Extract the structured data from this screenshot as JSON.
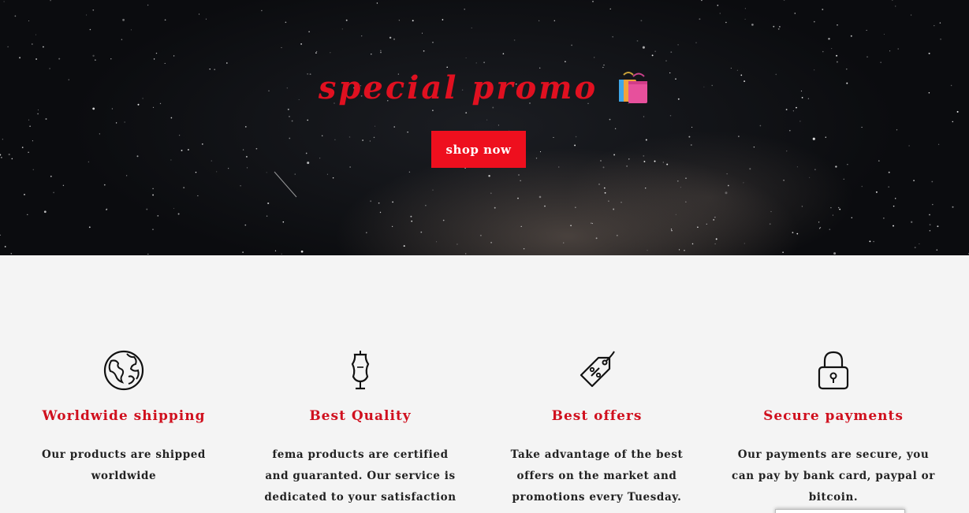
{
  "hero": {
    "title": "special promo",
    "emoji": "shopping-bags-icon",
    "button_label": "shop now",
    "accent_color": "#ee0f1e"
  },
  "features": [
    {
      "icon": "globe-icon",
      "title": "Worldwide shipping",
      "description": "Our products are shipped worldwide"
    },
    {
      "icon": "dress-mannequin-icon",
      "title": "Best Quality",
      "description": "fema products are certified and guaranted. Our service is dedicated to your satisfaction"
    },
    {
      "icon": "price-tag-icon",
      "title": "Best offers",
      "description": "Take advantage of the best offers on the market and promotions every Tuesday."
    },
    {
      "icon": "padlock-icon",
      "title": "Secure payments",
      "description": "Our payments are secure, you can pay by bank card, paypal or bitcoin."
    }
  ]
}
